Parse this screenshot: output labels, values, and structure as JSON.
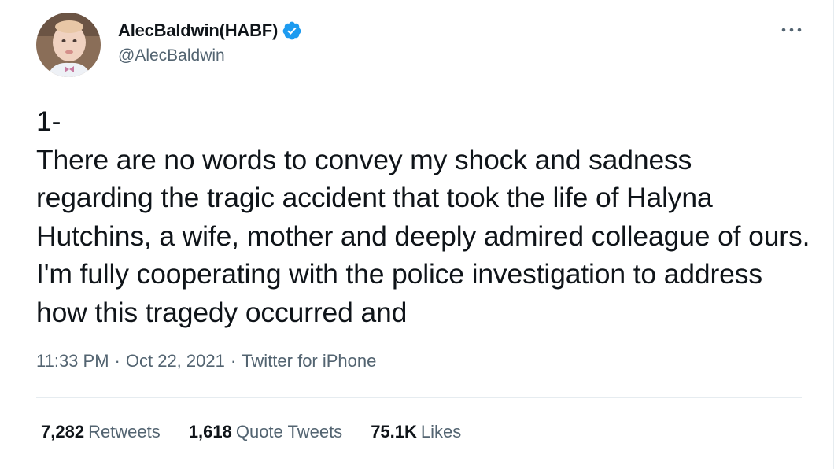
{
  "author": {
    "display_name": "AlecBaldwin(HABF)",
    "handle": "@AlecBaldwin",
    "verified": true,
    "avatar_icon": "baby-portrait-avatar"
  },
  "menu": {
    "more_icon": "ellipsis-icon"
  },
  "tweet": {
    "text": "1-\nThere are no words to convey my shock and sadness regarding the tragic accident that took the life of Halyna Hutchins, a wife, mother and deeply admired colleague of ours. I'm fully cooperating with the police investigation to address how this tragedy occurred and"
  },
  "meta": {
    "time": "11:33 PM",
    "separator": "·",
    "date": "Oct 22, 2021",
    "source": "Twitter for iPhone"
  },
  "stats": {
    "retweets": {
      "count": "7,282",
      "label": "Retweets"
    },
    "quote_tweets": {
      "count": "1,618",
      "label": "Quote Tweets"
    },
    "likes": {
      "count": "75.1K",
      "label": "Likes"
    }
  },
  "colors": {
    "text_primary": "#0f1419",
    "text_secondary": "#536471",
    "verified_blue": "#1d9bf0",
    "divider": "#e6ecf0"
  }
}
